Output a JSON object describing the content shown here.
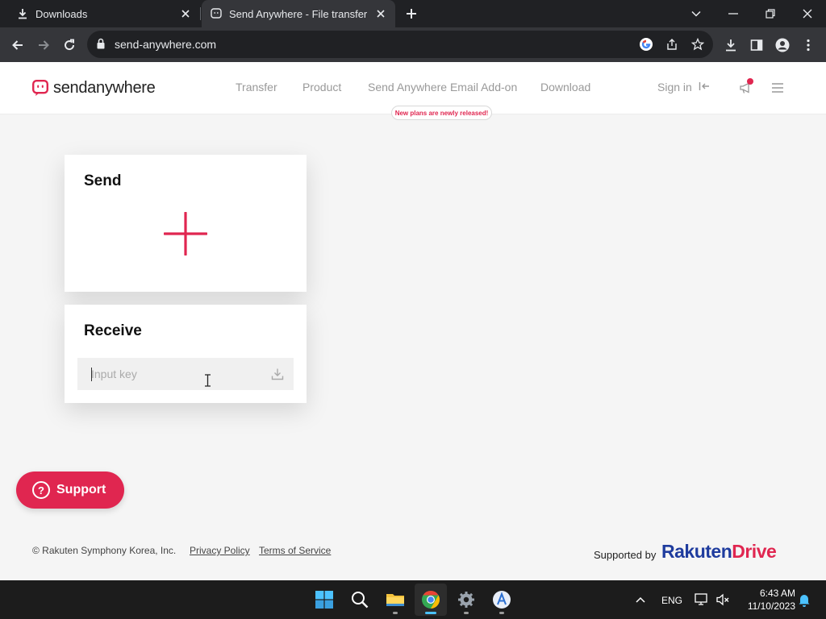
{
  "browser": {
    "tabs": [
      {
        "title": "Downloads",
        "icon": "download-icon",
        "active": false
      },
      {
        "title": "Send Anywhere - File transfer",
        "icon": "sendanywhere-favicon",
        "active": true
      }
    ],
    "url": "send-anywhere.com"
  },
  "site": {
    "logo_text_bold": "send",
    "logo_text_rest": "anywhere",
    "nav": [
      "Transfer",
      "Product",
      "Send Anywhere Email Add-on",
      "Download"
    ],
    "promo_badge": "New plans are newly released!",
    "sign_in": "Sign in"
  },
  "send_card": {
    "title": "Send"
  },
  "receive_card": {
    "title": "Receive",
    "input_placeholder": "Input key",
    "input_value": ""
  },
  "support": {
    "label": "Support",
    "icon_glyph": "?"
  },
  "footer": {
    "copyright": "© Rakuten Symphony Korea, Inc.",
    "links": [
      "Privacy Policy",
      "Terms of Service"
    ],
    "supported_by": "Supported by",
    "partner_brand_part1": "Rakuten",
    "partner_brand_part2": "Drive"
  },
  "taskbar": {
    "language": "ENG",
    "time": "6:43 AM",
    "date": "11/10/2023"
  },
  "colors": {
    "accent": "#e02650",
    "brand_blue": "#1f3c9e",
    "chrome_dark": "#202124",
    "chrome_toolbar": "#35363a",
    "page_bg": "#f5f5f5"
  }
}
